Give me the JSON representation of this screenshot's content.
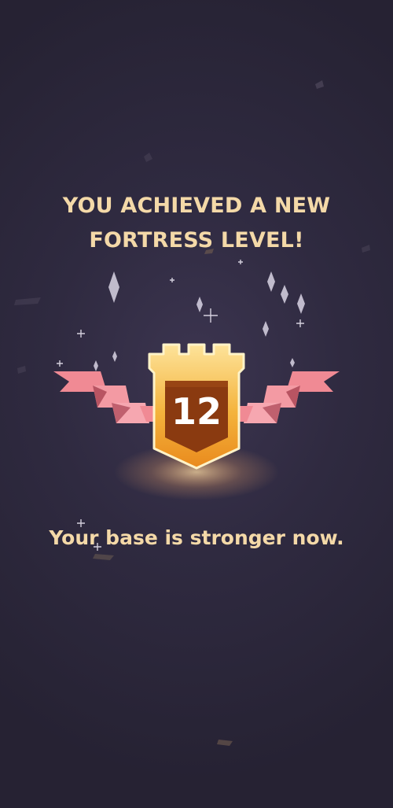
{
  "headline": {
    "line1": "YOU ACHIEVED A NEW",
    "line2": "FORTRESS LEVEL!"
  },
  "badge": {
    "level": "12",
    "icon": "fortress-tower-icon"
  },
  "subtitle": "Your base is stronger now.",
  "colors": {
    "background": "#2f2a40",
    "text": "#f4d9a8",
    "ribbon": "#f08a94",
    "tower_gold": "#f3a52c",
    "tower_shield": "#8a3a10",
    "glow": "#f9c982"
  },
  "decorations": [
    "sparkle-icon",
    "confetti-icon"
  ]
}
